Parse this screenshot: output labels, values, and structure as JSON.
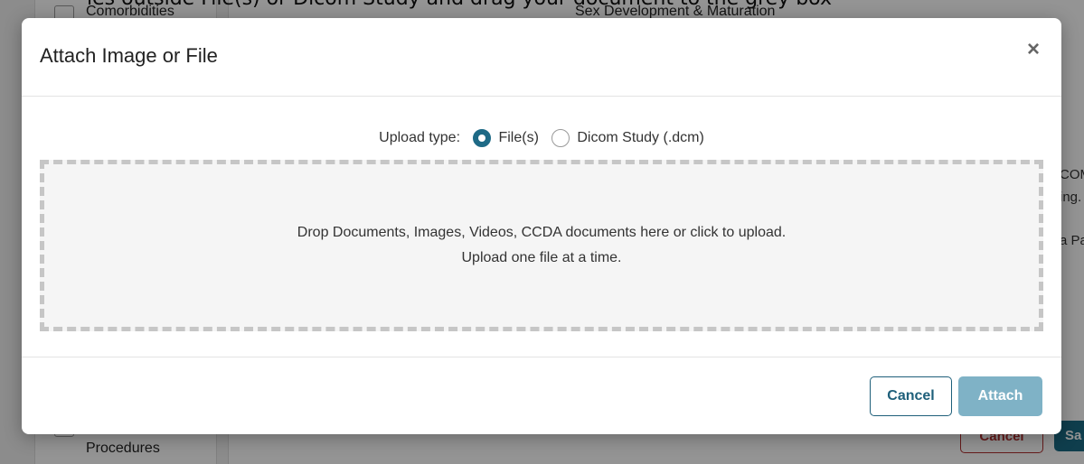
{
  "background": {
    "caption": "les outside File(s) or Dicom Study and drag your document to the grey box",
    "left_items": [
      "Comorbidities",
      "Procedures"
    ],
    "center_label": "Sex Development & Maturation",
    "right_fragments": [
      "COM",
      "ing.",
      "a Pa"
    ],
    "cancel_label": "Cancel",
    "save_label": "Sa"
  },
  "modal": {
    "title": "Attach Image or File",
    "close_icon": "×",
    "upload_type": {
      "label": "Upload type:",
      "options": [
        {
          "label": "File(s)",
          "selected": true
        },
        {
          "label": "Dicom Study (.dcm)",
          "selected": false
        }
      ]
    },
    "dropzone": {
      "line1": "Drop Documents, Images, Videos, CCDA documents here or click to upload.",
      "line2": "Upload one file at a time."
    },
    "buttons": {
      "cancel": "Cancel",
      "attach": "Attach"
    }
  },
  "colors": {
    "accent": "#1e6a86",
    "attach_disabled": "#7fb2c6",
    "dropzone_border": "#c6c6c6"
  }
}
